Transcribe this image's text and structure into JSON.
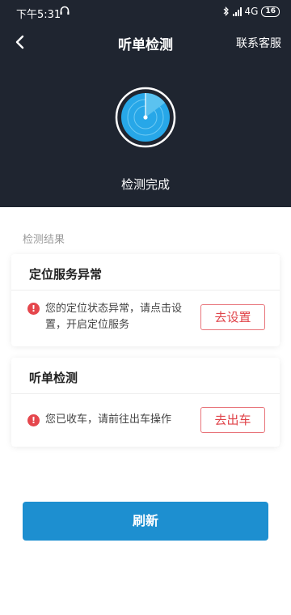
{
  "status_bar": {
    "time": "下午5:31",
    "network": "4G",
    "battery": "16"
  },
  "nav": {
    "title": "听单检测",
    "service_label": "联系客服"
  },
  "header": {
    "status_text": "检测完成"
  },
  "results": {
    "section_label": "检测结果",
    "cards": [
      {
        "title": "定位服务异常",
        "message": "您的定位状态异常，请点击设置，开启定位服务",
        "action_label": "去设置"
      },
      {
        "title": "听单检测",
        "message": "您已收车，请前往出车操作",
        "action_label": "去出车"
      }
    ]
  },
  "refresh_label": "刷新",
  "colors": {
    "header_bg": "#1f2530",
    "primary": "#1d8fd0",
    "alert": "#e5474d"
  }
}
